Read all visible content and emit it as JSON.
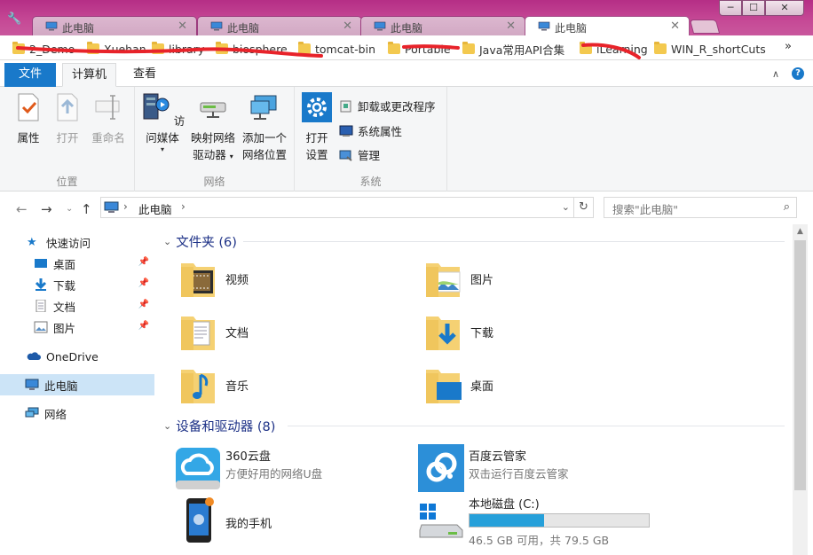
{
  "browser": {
    "tabs": [
      {
        "label": "此电脑",
        "close": "✕"
      },
      {
        "label": "此电脑",
        "close": "✕"
      },
      {
        "label": "此电脑",
        "close": "✕"
      },
      {
        "label": "此电脑",
        "close": "✕"
      }
    ],
    "window_buttons": {
      "minimize": "─",
      "maximize": "☐",
      "close": "✕"
    },
    "bookmarks": [
      {
        "label": "2_Demo"
      },
      {
        "label": "Xuehan"
      },
      {
        "label": "library"
      },
      {
        "label": "biosphere"
      },
      {
        "label": "tomcat-bin"
      },
      {
        "label": "Portable"
      },
      {
        "label": "Java常用API合集"
      },
      {
        "label": "iLearning"
      },
      {
        "label": "WIN_R_shortCuts"
      }
    ],
    "bookmarks_more": "»"
  },
  "ribbon": {
    "tabs": {
      "file": "文件",
      "computer": "计算机",
      "view": "查看"
    },
    "collapse": "∧",
    "help": "?",
    "groups": {
      "location": {
        "label": "位置",
        "properties": "属性",
        "open": "打开",
        "rename": "重命名"
      },
      "network": {
        "label": "网络",
        "access_media": "访问媒体",
        "map_drive_line1": "映射网络",
        "map_drive_line2": "驱动器",
        "add_location_line1": "添加一个",
        "add_location_line2": "网络位置"
      },
      "system": {
        "label": "系统",
        "open_settings_line1": "打开",
        "open_settings_line2": "设置",
        "uninstall": "卸载或更改程序",
        "system_properties": "系统属性",
        "manage": "管理"
      }
    }
  },
  "address": {
    "crumb": "此电脑",
    "sep": "›",
    "search_placeholder": "搜索\"此电脑\""
  },
  "navpane": {
    "quick_access": "快速访问",
    "desktop": "桌面",
    "downloads": "下载",
    "documents": "文档",
    "pictures": "图片",
    "onedrive": "OneDrive",
    "this_pc": "此电脑",
    "network": "网络"
  },
  "content": {
    "folders_header": "文件夹 (6)",
    "devices_header": "设备和驱动器 (8)",
    "folders": [
      "视频",
      "图片",
      "文档",
      "下载",
      "音乐",
      "桌面"
    ],
    "drives": [
      {
        "name": "360云盘",
        "desc": "方便好用的网络U盘"
      },
      {
        "name": "百度云管家",
        "desc": "双击运行百度云管家"
      },
      {
        "name": "我的手机",
        "desc": ""
      },
      {
        "name": "本地磁盘 (C:)",
        "desc": "46.5 GB 可用，共 79.5 GB",
        "used_fraction": 0.415
      }
    ]
  },
  "colors": {
    "accent": "#1979ca",
    "titlebar": "#c64a96",
    "section_header": "#1e3287",
    "selection": "#cce4f7",
    "capacity_bar": "#26a0da"
  }
}
